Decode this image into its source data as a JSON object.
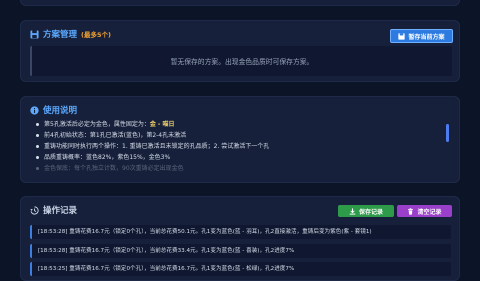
{
  "plan": {
    "title": "方案管理",
    "subtitle": "(最多5个)",
    "save_button": "暂存当前方案",
    "empty_text": "暂无保存的方案。出现金色品质时可保存方案。"
  },
  "usage": {
    "title": "使用说明",
    "items": [
      {
        "text": "第5孔激活后必定为金色，属性固定为：",
        "highlight": "金 - 喵日"
      },
      {
        "text": "前4孔初始状态：第1孔已激活(蓝色)，第2-4孔未激活",
        "highlight": ""
      },
      {
        "text": "重铸功能同时执行两个操作：1. 重铸已激活且未锁定的孔品质；2. 尝试激活下一个孔",
        "highlight": ""
      },
      {
        "text": "品质重铸概率：蓝色82%，紫色15%，金色3%",
        "highlight": ""
      },
      {
        "text": "金色保底：每个孔独立计数，90次重铸必定出现金色",
        "highlight": ""
      }
    ]
  },
  "log": {
    "title": "操作记录",
    "save_button": "保存记录",
    "clear_button": "清空记录",
    "entries": [
      "[18:53:28] 重铸花费16.7元（锁定0个孔），当前总花费50.1元。孔1变为蓝色(蓝 - 羽耳)，孔2直接激活，重铸后变为紫色(紫 - 套镜1)",
      "[18:53:28] 重铸花费16.7元（锁定0个孔），当前总花费33.4元。孔1变为蓝色(蓝 - 喜装)，孔2进度7%",
      "[18:53:25] 重铸花费16.7元（锁定0个孔），当前总花费16.7元。孔1变为蓝色(蓝 - 松绿)，孔2进度7%"
    ]
  },
  "colors": {
    "background": "#0c1427",
    "panel": "#16203a",
    "accent_blue": "#2d7be0",
    "title_blue": "#5da9ff",
    "subtitle_orange": "#f0a030",
    "save_green": "#2e9b4a",
    "clear_purple": "#9a3fc9",
    "highlight_gold": "#f2d36b"
  },
  "icons": {
    "plan": "floppy-disk-icon",
    "usage": "info-circle-icon",
    "log": "history-icon",
    "save_log": "download-icon",
    "clear_log": "trash-icon"
  }
}
